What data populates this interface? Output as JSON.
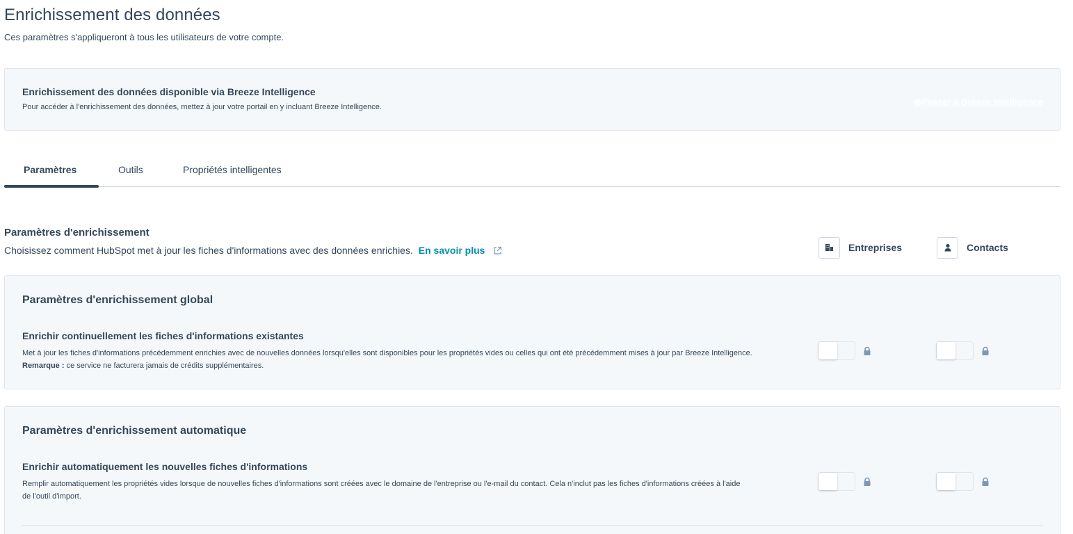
{
  "page": {
    "title": "Enrichissement des données",
    "subtitle": "Ces paramètres s'appliqueront à tous les utilisateurs de votre compte."
  },
  "banner": {
    "title": "Enrichissement des données disponible via Breeze Intelligence",
    "description": "Pour accéder à l'enrichissement des données, mettez à jour votre portail en y incluant Breeze Intelligence.",
    "link": "Passer à Breeze Intelligence"
  },
  "tabs": [
    {
      "label": "Paramètres",
      "active": true
    },
    {
      "label": "Outils",
      "active": false
    },
    {
      "label": "Propriétés intelligentes",
      "active": false
    }
  ],
  "enrichment": {
    "title": "Paramètres d'enrichissement",
    "description": "Choisissez comment HubSpot met à jour les fiches d'informations avec des données enrichies.",
    "learn_more": "En savoir plus"
  },
  "columns": {
    "companies": "Entreprises",
    "contacts": "Contacts"
  },
  "global_card": {
    "title": "Paramètres d'enrichissement global",
    "setting_title": "Enrichir continuellement les fiches d'informations existantes",
    "setting_desc": "Met à jour les fiches d'informations précédemment enrichies avec de nouvelles données lorsqu'elles sont disponibles pour les propriétés vides ou celles qui ont été précédemment mises à jour par Breeze Intelligence.",
    "note_label": "Remarque :",
    "note_text": "ce service ne facturera jamais de crédits supplémentaires."
  },
  "auto_card": {
    "title": "Paramètres d'enrichissement automatique",
    "setting_title": "Enrichir automatiquement les nouvelles fiches d'informations",
    "setting_desc": "Remplir automatiquement les propriétés vides lorsque de nouvelles fiches d'informations sont créées avec le domaine de l'entreprise ou l'e-mail du contact. Cela n'inclut pas les fiches d'informations créées à l'aide de l'outil d'import."
  },
  "colors": {
    "text": "#33475b",
    "link": "#0091ae",
    "card_bg": "#f5f8fa",
    "border": "#dfe3eb"
  }
}
